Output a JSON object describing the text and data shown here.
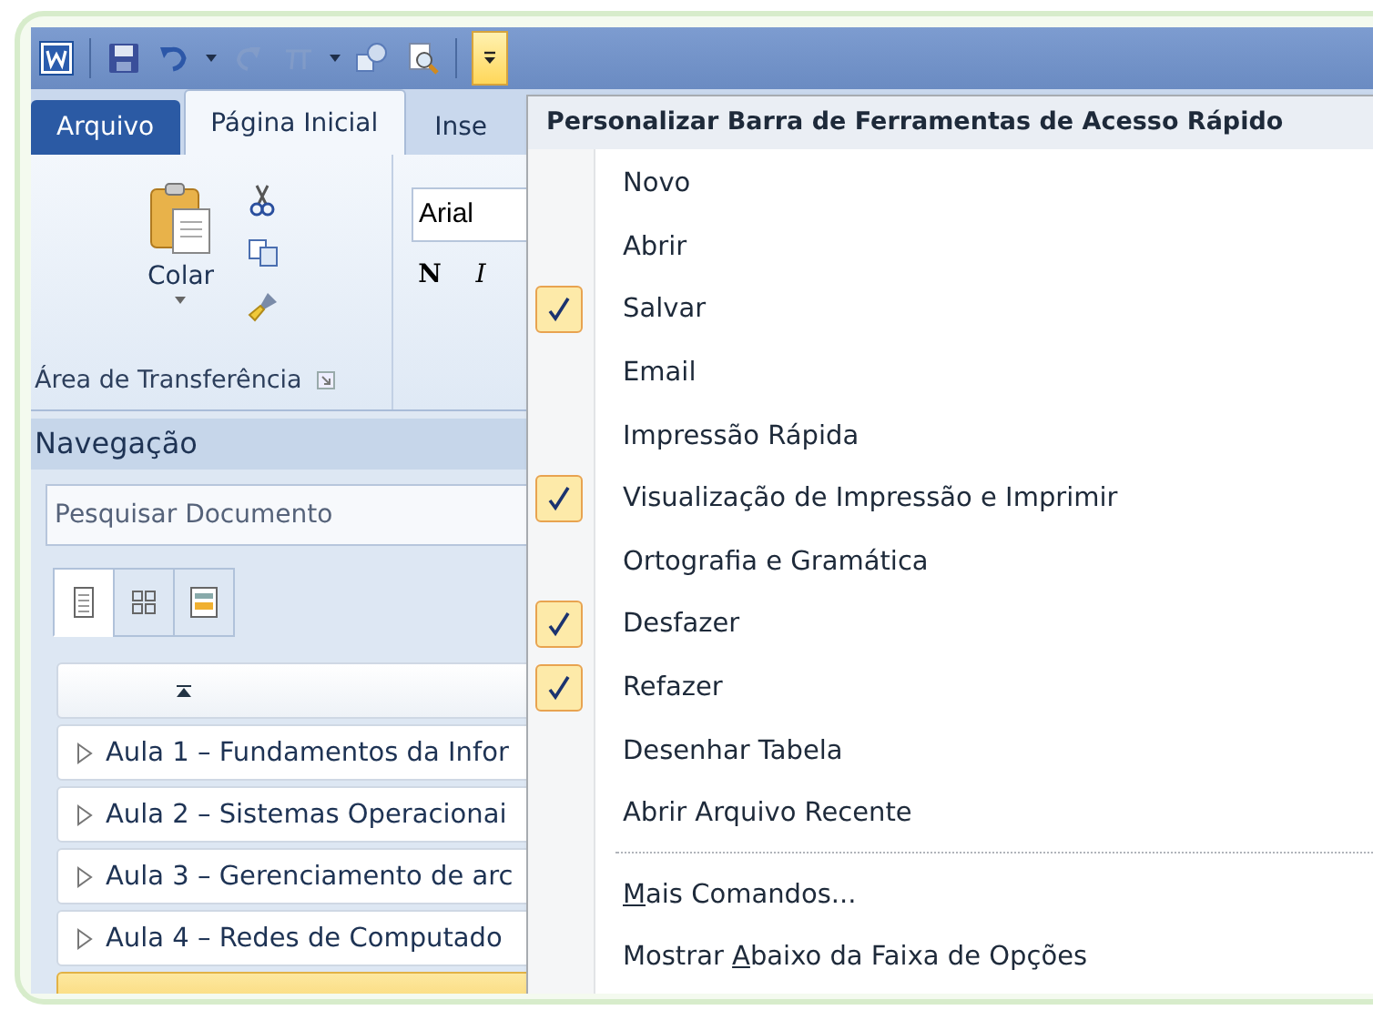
{
  "quick_access_toolbar": {
    "items": [
      {
        "kind": "word"
      },
      {
        "kind": "sep"
      },
      {
        "kind": "save",
        "disabled": false
      },
      {
        "kind": "undo",
        "disabled": false
      },
      {
        "kind": "caret",
        "disabled": false
      },
      {
        "kind": "redo",
        "disabled": true
      },
      {
        "kind": "pi",
        "disabled": true
      },
      {
        "kind": "caret",
        "disabled": false
      },
      {
        "kind": "shapes",
        "disabled": false
      },
      {
        "kind": "preview",
        "disabled": false
      },
      {
        "kind": "sep"
      }
    ],
    "customize_button": {
      "expanded": true
    }
  },
  "ribbon_tabs": [
    {
      "label": "Arquivo",
      "kind": "file",
      "selected": false
    },
    {
      "label": "Página Inicial",
      "kind": "tab",
      "selected": true
    },
    {
      "label": "Inse",
      "kind": "tab",
      "selected": false
    }
  ],
  "ribbon": {
    "paste_label": "Colar",
    "clipboard_group": "Área de Transferência",
    "font_name": "Arial",
    "bold": "N",
    "italic": "I"
  },
  "navigation": {
    "title": "Navegação",
    "search": {
      "placeholder": "Pesquisar Documento"
    },
    "view_tabs": [
      {
        "kind": "headings",
        "selected": true
      },
      {
        "kind": "pages",
        "selected": false
      },
      {
        "kind": "results",
        "selected": false
      }
    ],
    "items": [
      {
        "label": "Aula 1 – Fundamentos da Infor",
        "selected": false
      },
      {
        "label": "Aula 2 – Sistemas Operacionai",
        "selected": false
      },
      {
        "label": "Aula 3 – Gerenciamento de arc",
        "selected": false
      },
      {
        "label": "Aula 4 – Redes de Computado",
        "selected": false
      },
      {
        "selected": true
      }
    ]
  },
  "menu": {
    "title": "Personalizar Barra de Ferramentas de Acesso Rápido",
    "items": [
      {
        "kind": "toggle",
        "label": "Novo",
        "checked": false
      },
      {
        "kind": "toggle",
        "label": "Abrir",
        "checked": false
      },
      {
        "kind": "toggle",
        "label": "Salvar",
        "checked": true
      },
      {
        "kind": "toggle",
        "label": "Email",
        "checked": false
      },
      {
        "kind": "toggle",
        "label": "Impressão Rápida",
        "checked": false
      },
      {
        "kind": "toggle",
        "label": "Visualização de Impressão e Imprimir",
        "checked": true
      },
      {
        "kind": "toggle",
        "label": "Ortografia e Gramática",
        "checked": false
      },
      {
        "kind": "toggle",
        "label": "Desfazer",
        "checked": true
      },
      {
        "kind": "toggle",
        "label": "Refazer",
        "checked": true
      },
      {
        "kind": "toggle",
        "label": "Desenhar Tabela",
        "checked": false
      },
      {
        "kind": "toggle",
        "label": "Abrir Arquivo Recente",
        "checked": false
      },
      {
        "kind": "separator"
      },
      {
        "kind": "command",
        "mnemonic": "M",
        "after": "ais Comandos..."
      },
      {
        "kind": "command",
        "before": "Mostrar ",
        "mnemonic": "A",
        "after": "baixo da Faixa de Opções"
      }
    ]
  }
}
